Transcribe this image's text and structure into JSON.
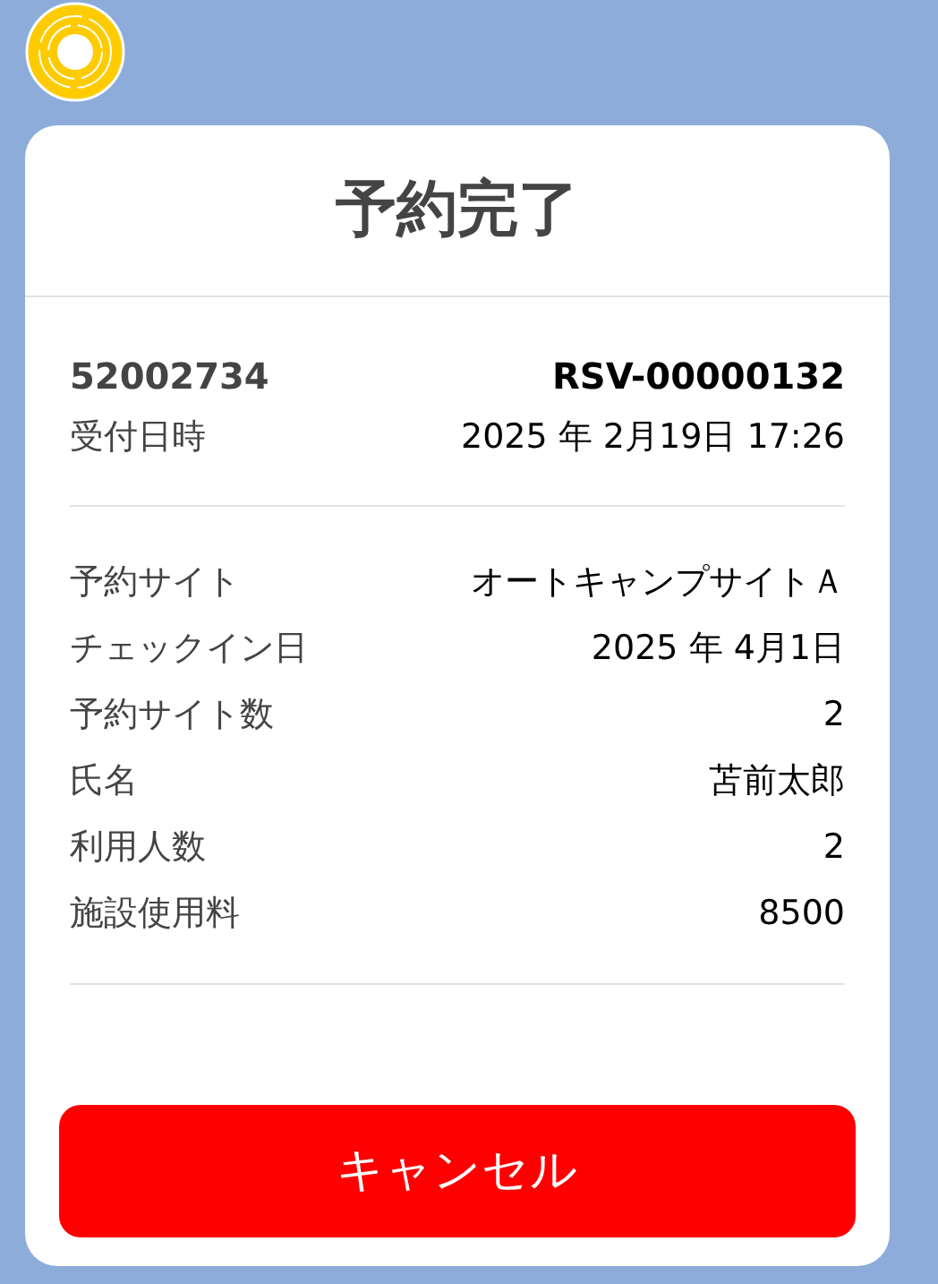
{
  "title": "予約完了",
  "header": {
    "number": "52002734",
    "reservation_id": "RSV-00000132",
    "label": "受付日時",
    "value": "2025 年 2月19日 17:26"
  },
  "details": [
    {
      "label": "予約サイト",
      "value": "オートキャンプサイトＡ"
    },
    {
      "label": "チェックイン日",
      "value": "2025 年 4月1日"
    },
    {
      "label": "予約サイト数",
      "value": "2"
    },
    {
      "label": "氏名",
      "value": "苫前太郎"
    },
    {
      "label": "利用人数",
      "value": "2"
    },
    {
      "label": "施設使用料",
      "value": "8500"
    }
  ],
  "cancel_button": "キャンセル"
}
